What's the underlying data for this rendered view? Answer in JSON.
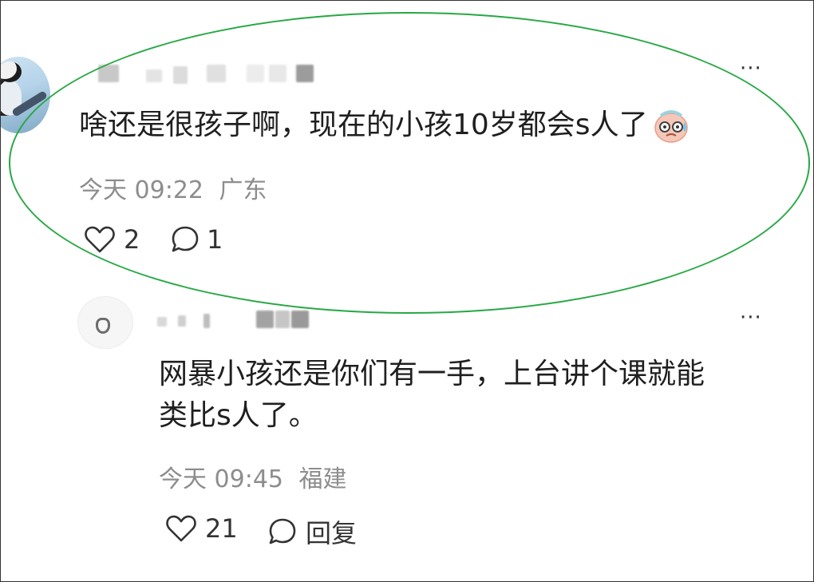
{
  "comments": [
    {
      "text": "啥还是很孩子啊，现在的小孩10岁都会s人了",
      "time": "今天 09:22",
      "location": "广东",
      "like_count": "2",
      "reply_count": "1"
    },
    {
      "text_line1": "网暴小孩还是你们有一手，上台讲个课就能",
      "text_line2": "类比s人了。",
      "time": "今天 09:45",
      "location": "福建",
      "like_count": "21",
      "reply_label": "回复"
    }
  ],
  "more_label": "···",
  "colors": {
    "highlight_oval": "#27a844",
    "body_text": "#1f1f1f",
    "meta_text": "#8d8d8d"
  },
  "icons": {
    "like": "heart-outline-icon",
    "reply": "speech-bubble-icon",
    "more": "more-dots-icon",
    "emoji": "sweating-face-emoji"
  }
}
